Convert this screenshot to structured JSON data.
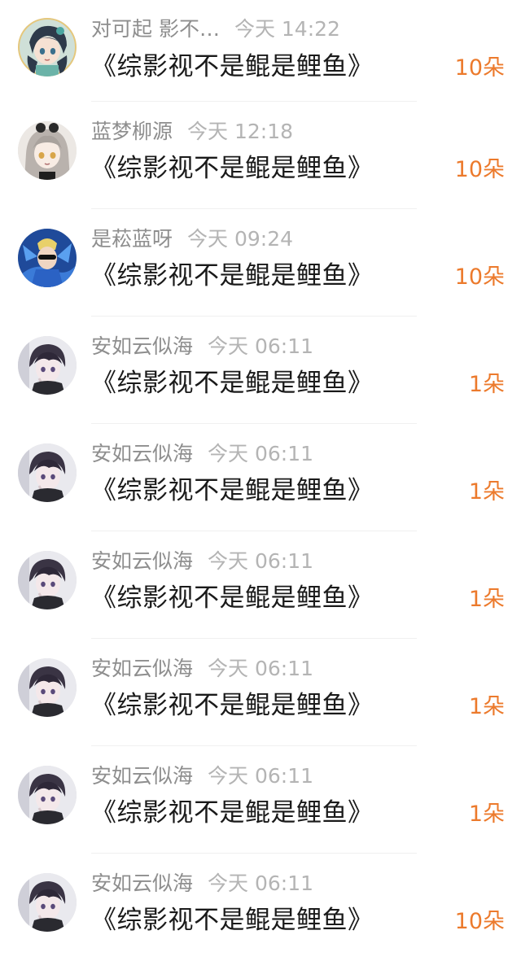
{
  "gifts": [
    {
      "username": "对可起 影不…",
      "time": "今天 14:22",
      "title": "《综影视不是鲲是鲤鱼》",
      "count": "10朵",
      "avatar": "anime-girl-teal-hair-avatar"
    },
    {
      "username": "蓝梦柳源",
      "time": "今天 12:18",
      "title": "《综影视不是鲲是鲤鱼》",
      "count": "10朵",
      "avatar": "anime-girl-grey-hair-avatar"
    },
    {
      "username": "是菘蓝呀",
      "time": "今天 09:24",
      "title": "《综影视不是鲲是鲤鱼》",
      "count": "10朵",
      "avatar": "blue-character-sunglasses-avatar"
    },
    {
      "username": "安如云似海",
      "time": "今天 06:11",
      "title": "《综影视不是鲲是鲤鱼》",
      "count": "1朵",
      "avatar": "anime-boy-dark-hair-avatar"
    },
    {
      "username": "安如云似海",
      "time": "今天 06:11",
      "title": "《综影视不是鲲是鲤鱼》",
      "count": "1朵",
      "avatar": "anime-boy-dark-hair-avatar"
    },
    {
      "username": "安如云似海",
      "time": "今天 06:11",
      "title": "《综影视不是鲲是鲤鱼》",
      "count": "1朵",
      "avatar": "anime-boy-dark-hair-avatar"
    },
    {
      "username": "安如云似海",
      "time": "今天 06:11",
      "title": "《综影视不是鲲是鲤鱼》",
      "count": "1朵",
      "avatar": "anime-boy-dark-hair-avatar"
    },
    {
      "username": "安如云似海",
      "time": "今天 06:11",
      "title": "《综影视不是鲲是鲤鱼》",
      "count": "1朵",
      "avatar": "anime-boy-dark-hair-avatar"
    },
    {
      "username": "安如云似海",
      "time": "今天 06:11",
      "title": "《综影视不是鲲是鲤鱼》",
      "count": "10朵",
      "avatar": "anime-boy-dark-hair-avatar"
    }
  ],
  "colors": {
    "count_accent": "#ec7a2c",
    "username": "#8e8e8e",
    "time": "#b4b4b4",
    "title": "#1a1a1a"
  }
}
